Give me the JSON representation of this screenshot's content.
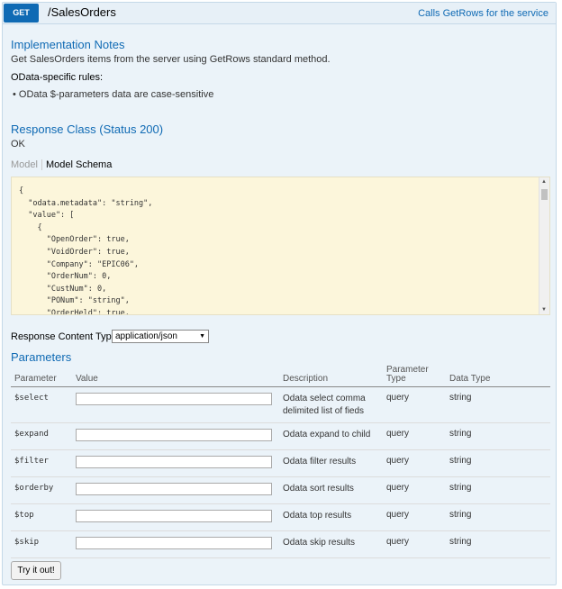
{
  "operation": {
    "method": "GET",
    "path": "/SalesOrders",
    "summary": "Calls GetRows for the service"
  },
  "implementation_notes": {
    "title": "Implementation Notes",
    "text": "Get SalesOrders items from the server using GetRows standard method.",
    "rules_title": "OData-specific rules:",
    "rules": [
      "OData $-parameters data are case-sensitive"
    ]
  },
  "response_class": {
    "title": "Response Class (Status 200)",
    "status_text": "OK",
    "tab_model": "Model",
    "tab_schema": "Model Schema",
    "schema_lines": [
      "{",
      "  \"odata.metadata\": \"string\",",
      "  \"value\": [",
      "    {",
      "      \"OpenOrder\": true,",
      "      \"VoidOrder\": true,",
      "      \"Company\": \"EPIC06\",",
      "      \"OrderNum\": 0,",
      "      \"CustNum\": 0,",
      "      \"PONum\": \"string\",",
      "      \"OrderHeld\": true,"
    ]
  },
  "response_content_type": {
    "label": "Response Content Type",
    "selected": "application/json"
  },
  "parameters": {
    "title": "Parameters",
    "headers": {
      "parameter": "Parameter",
      "value": "Value",
      "description": "Description",
      "param_type_1": "Parameter",
      "param_type_2": "Type",
      "data_type": "Data Type"
    },
    "rows": [
      {
        "name": "$select",
        "value": "",
        "description_1": "Odata select comma",
        "description_2": "delimited list of fieds",
        "type": "query",
        "data_type": "string"
      },
      {
        "name": "$expand",
        "value": "",
        "description_1": "Odata expand to child",
        "description_2": "",
        "type": "query",
        "data_type": "string"
      },
      {
        "name": "$filter",
        "value": "",
        "description_1": "Odata filter results",
        "description_2": "",
        "type": "query",
        "data_type": "string"
      },
      {
        "name": "$orderby",
        "value": "",
        "description_1": "Odata sort results",
        "description_2": "",
        "type": "query",
        "data_type": "string"
      },
      {
        "name": "$top",
        "value": "",
        "description_1": "Odata top results",
        "description_2": "",
        "type": "query",
        "data_type": "string"
      },
      {
        "name": "$skip",
        "value": "",
        "description_1": "Odata skip results",
        "description_2": "",
        "type": "query",
        "data_type": "string"
      }
    ]
  },
  "submit": {
    "label": "Try it out!"
  }
}
